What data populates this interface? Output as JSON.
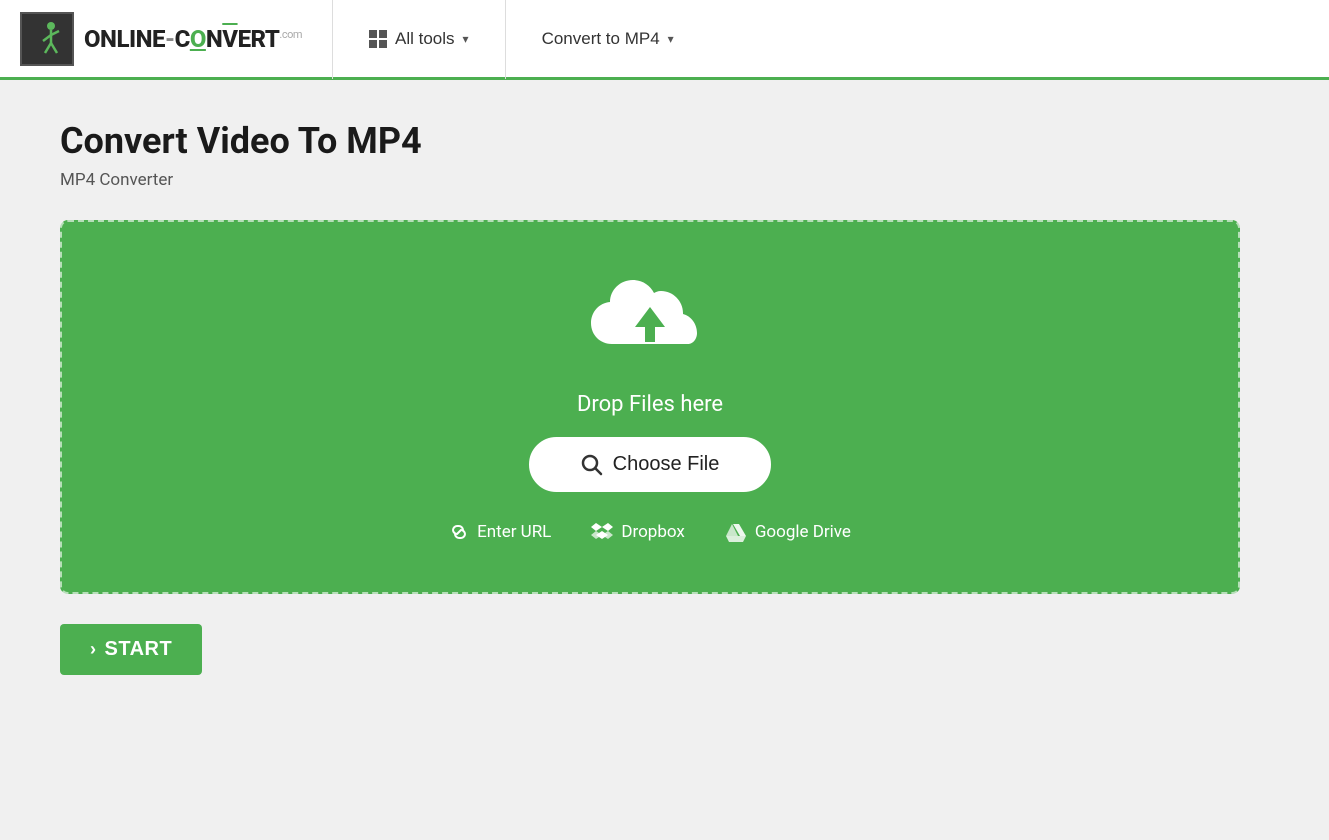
{
  "header": {
    "logo_text": "ONLINE-CONVERT",
    "logo_sup": ".com",
    "nav_all_tools": "All tools",
    "nav_convert_to": "Convert to MP4"
  },
  "page": {
    "title": "Convert Video To MP4",
    "subtitle": "MP4 Converter"
  },
  "upload": {
    "drop_text": "Drop Files here",
    "choose_file_label": "Choose File",
    "enter_url_label": "Enter URL",
    "dropbox_label": "Dropbox",
    "google_drive_label": "Google Drive"
  },
  "actions": {
    "start_label": "START"
  }
}
